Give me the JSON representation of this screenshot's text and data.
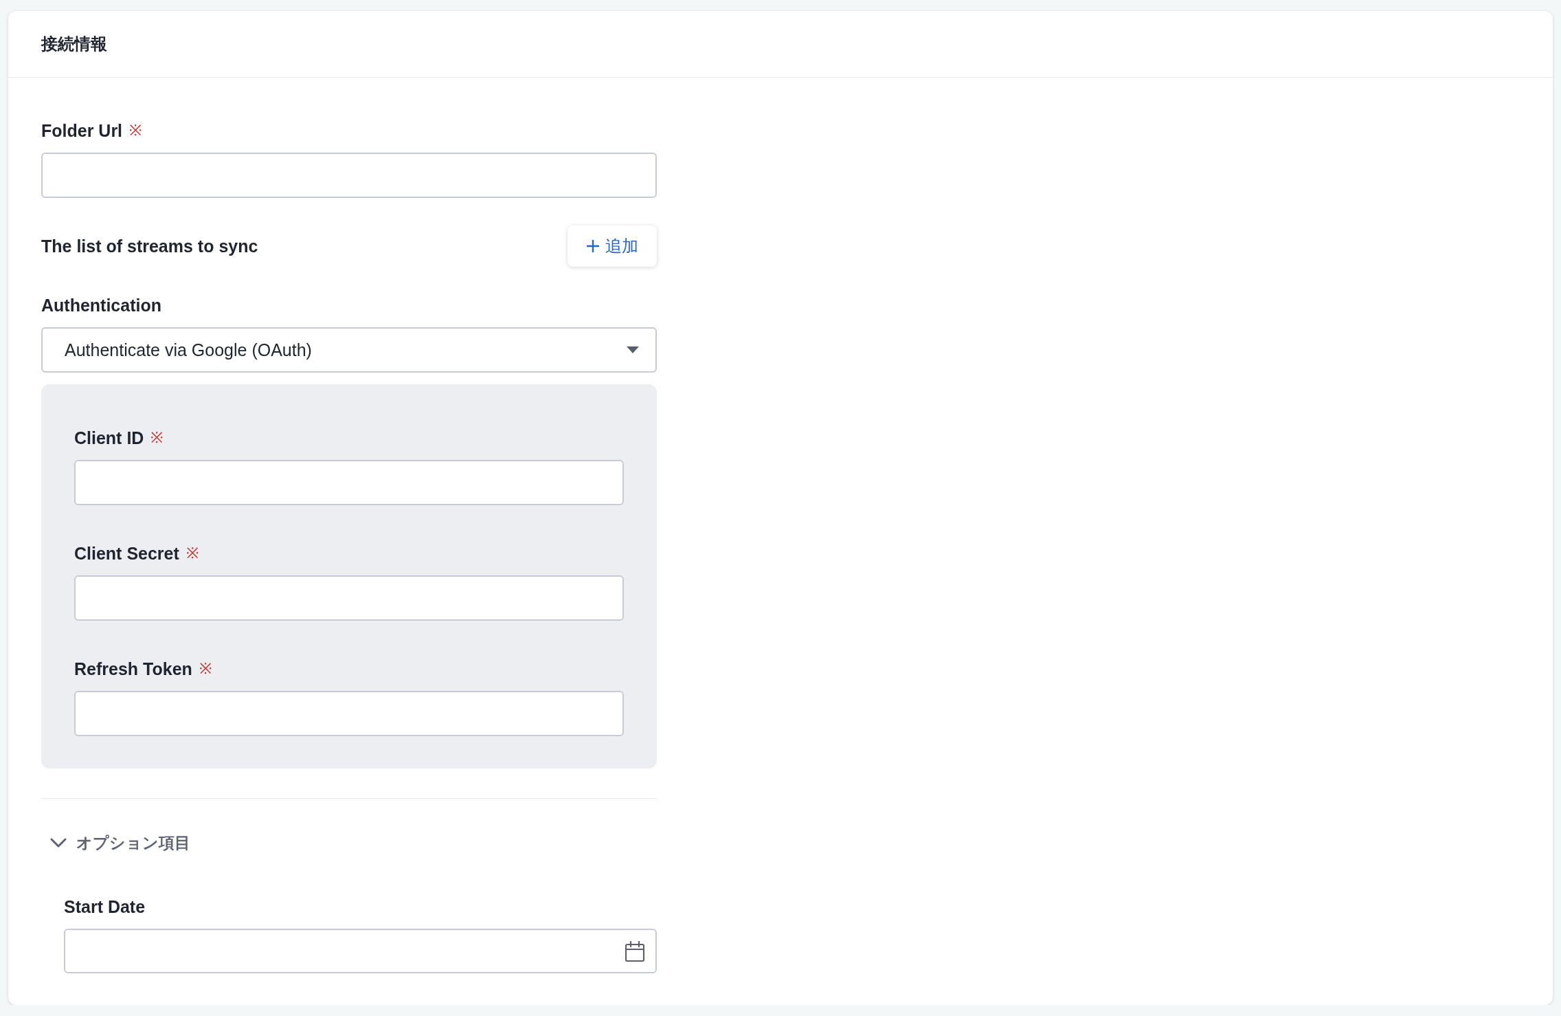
{
  "section": {
    "title": "接続情報"
  },
  "fields": [
    {
      "kind": "text",
      "label": "Folder Url",
      "required_mark": "※"
    },
    {
      "kind": "list",
      "label": "The list of streams to sync",
      "add_button": "追加"
    },
    {
      "kind": "select",
      "label": "Authentication",
      "value": "Authenticate via Google (OAuth)",
      "subfields": [
        {
          "kind": "text",
          "label": "Client ID",
          "required_mark": "※"
        },
        {
          "kind": "text",
          "label": "Client Secret",
          "required_mark": "※"
        },
        {
          "kind": "text",
          "label": "Refresh Token",
          "required_mark": "※"
        }
      ]
    }
  ],
  "options": {
    "label": "オプション項目",
    "expanded": true,
    "fields": [
      {
        "kind": "date",
        "label": "Start Date"
      }
    ]
  }
}
